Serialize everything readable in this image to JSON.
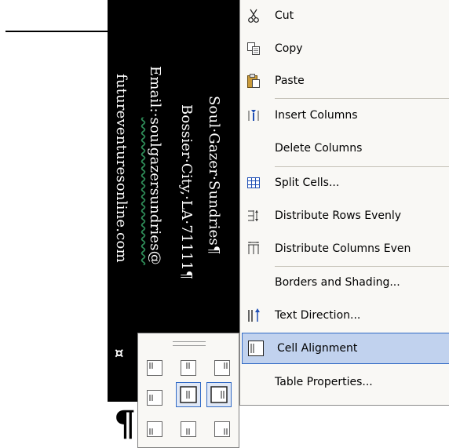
{
  "document": {
    "address_lines": [
      "Soul·Gazer·Sundries¶",
      "Bossier·City,·LA·71111¶",
      "Email:·soulgazersundries@",
      "futureventuresonline.com"
    ],
    "email_prefix": "Email:·",
    "email_link": "soulgazersundries@",
    "cell_marker": "¤",
    "paragraph_mark": "¶"
  },
  "context_menu": {
    "items": [
      {
        "label": "Cut",
        "icon": "scissors-icon"
      },
      {
        "label": "Copy",
        "icon": "copy-icon"
      },
      {
        "label": "Paste",
        "icon": "paste-icon"
      },
      {
        "label": "Insert Columns",
        "icon": "insert-columns-icon"
      },
      {
        "label": "Delete Columns",
        "icon": ""
      },
      {
        "label": "Split Cells...",
        "icon": "split-cells-icon"
      },
      {
        "label": "Distribute Rows Evenly",
        "icon": "distribute-rows-icon"
      },
      {
        "label": "Distribute Columns Even",
        "icon": "distribute-columns-icon"
      },
      {
        "label": "Borders and Shading...",
        "icon": ""
      },
      {
        "label": "Text Direction...",
        "icon": "text-direction-icon"
      },
      {
        "label": "Cell Alignment",
        "icon": "cell-alignment-icon",
        "selected": true
      },
      {
        "label": "Table Properties...",
        "icon": ""
      }
    ]
  },
  "alignment_palette": {
    "selected": "middle-center",
    "buttons": [
      "top-left",
      "top-center",
      "top-right",
      "middle-left",
      "middle-center",
      "middle-right",
      "bottom-left",
      "bottom-center",
      "bottom-right"
    ]
  },
  "colors": {
    "menu_background": "#f9f8f5",
    "selection_fill": "#c1d2ee",
    "selection_border": "#316ac5",
    "cell_background": "#000000",
    "cell_text": "#ffffff"
  }
}
